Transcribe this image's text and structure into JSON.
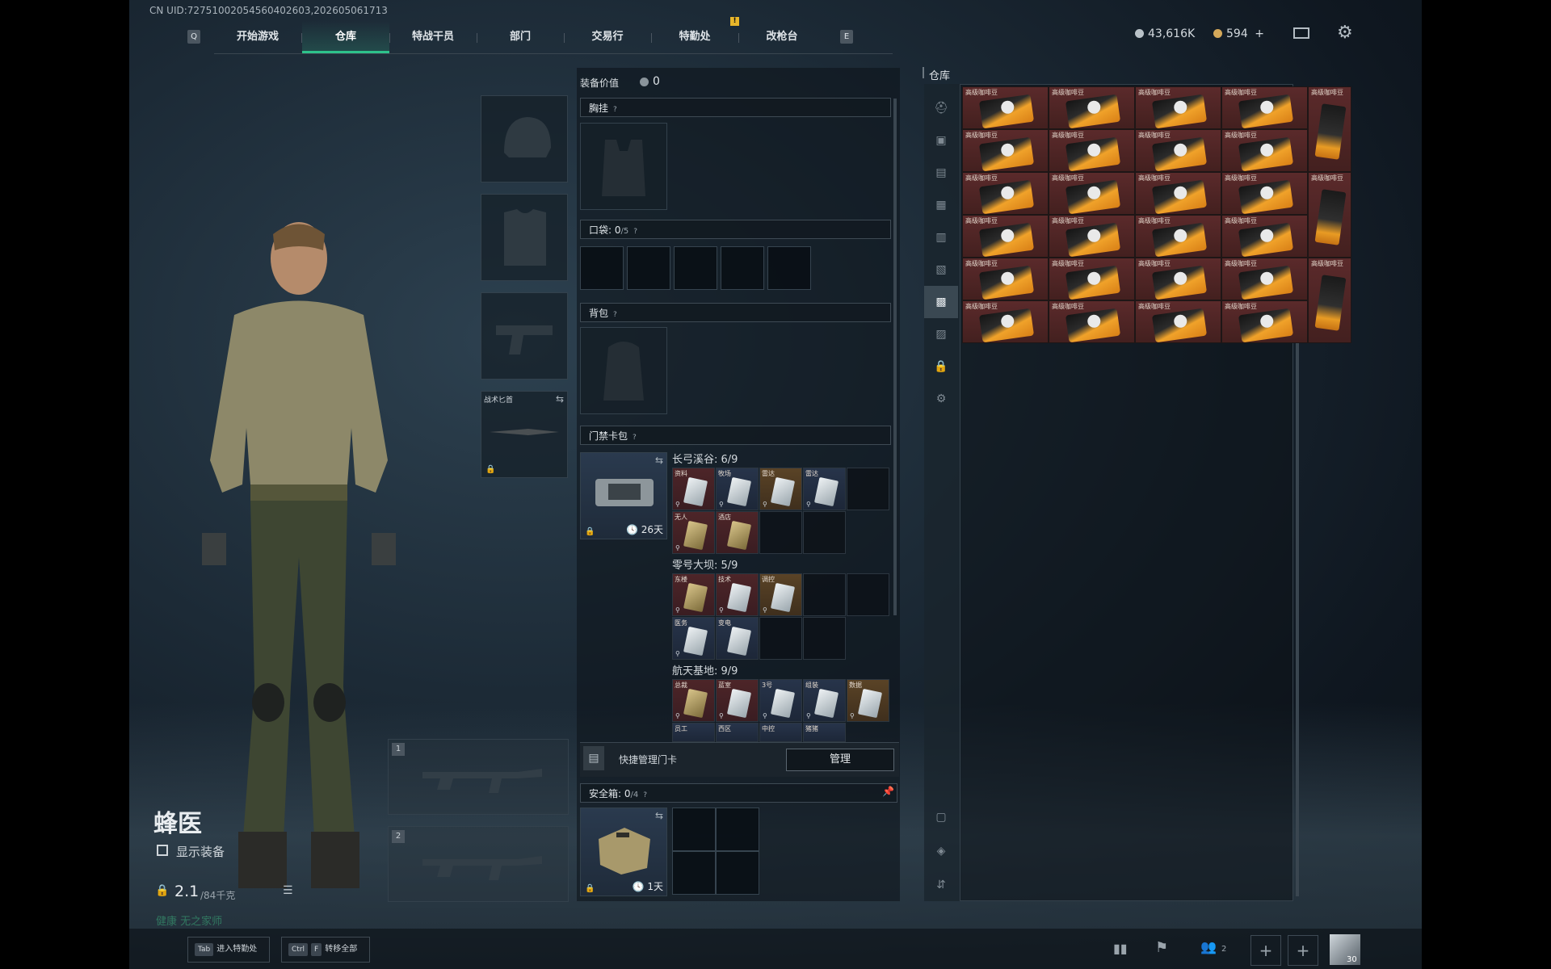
{
  "uid_text": "CN UID:7275100205456040260­3,202605061713",
  "nav": {
    "key_left": "Q",
    "key_right": "E",
    "tabs": [
      "开始游戏",
      "仓库",
      "特战干员",
      "部门",
      "交易行",
      "特勤处",
      "改枪台"
    ],
    "active_tab": "仓库",
    "alert_badge": "!"
  },
  "currency": {
    "silver": "43,616K",
    "gold": "594",
    "gold_add": "+"
  },
  "character": {
    "name": "蜂医",
    "show_equipment_label": "显示装备",
    "weight": "2.1",
    "weight_max": "/84千克",
    "status_text": "健康 无之家师"
  },
  "equipment_slots": {
    "knife_label": "战术匕首",
    "weapon_slot_1": "1",
    "weapon_slot_2": "2"
  },
  "loadout": {
    "value_label": "装备价值",
    "value": "0",
    "chest_label": "胸挂",
    "pocket_label": "口袋:",
    "pocket_count": "0",
    "pocket_max": "/5",
    "backpack_label": "背包",
    "keycard_label": "门禁卡包",
    "keycard_days": "26天",
    "groups": [
      {
        "name": "长弓溪谷",
        "count": "6/9"
      },
      {
        "name": "零号大坝",
        "count": "5/9"
      },
      {
        "name": "航天基地",
        "count": "9/9"
      }
    ],
    "quick_manage_label": "快捷管理门卡",
    "manage_button": "管理",
    "safebox_label": "安全箱:",
    "safebox_count": "0",
    "safebox_max": "/4",
    "safebox_days": "1天"
  },
  "card_names_g1": [
    "资料",
    "牧场",
    "雷达",
    "雷达",
    "无人",
    "酒店"
  ],
  "card_names_g2": [
    "东楼",
    "技术",
    "调控",
    "医务",
    "变电"
  ],
  "card_names_g3": [
    "总裁",
    "蓝室",
    "3号",
    "组装",
    "数据",
    "员工",
    "西区",
    "中控",
    "猪猪"
  ],
  "warehouse": {
    "title": "仓库",
    "item_name": "高级咖啡豆"
  },
  "bottom": {
    "btn1_key": "Tab",
    "btn1_label": "进入特勤处",
    "btn2_key1": "Ctrl",
    "btn2_key2": "F",
    "btn2_label": "转移全部",
    "friends_count": "2",
    "avatar_level": "30"
  },
  "colors": {
    "accent": "#2ec28b",
    "warehouse_item": "#5b2a2b",
    "coffee_orange": "#f0a22a"
  }
}
